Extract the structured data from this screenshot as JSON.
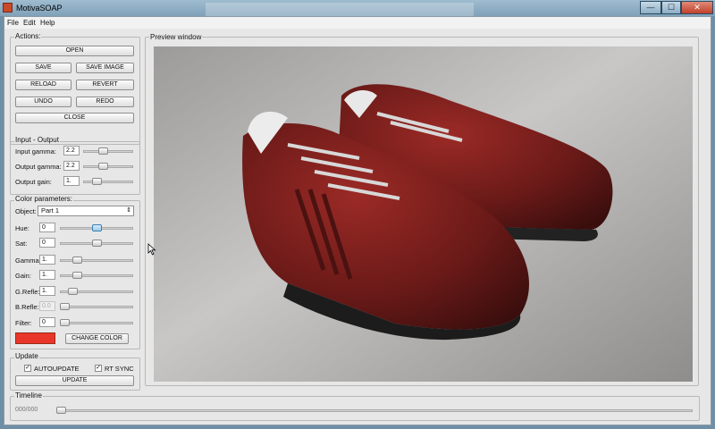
{
  "window": {
    "title": "MotivaSOAP",
    "minimize": "—",
    "maximize": "☐",
    "close": "✕"
  },
  "menu": [
    "File",
    "Edit",
    "Help"
  ],
  "actions": {
    "title": "Actions:",
    "open": "OPEN",
    "save": "SAVE",
    "save_image": "SAVE IMAGE",
    "reload": "RELOAD",
    "revert": "REVERT",
    "undo": "UNDO",
    "redo": "REDO",
    "close": "CLOSE"
  },
  "io": {
    "title": "Input - Output",
    "input_gamma_label": "Input gamma:",
    "input_gamma_value": "2.2",
    "input_gamma_level": 0.38,
    "output_gamma_label": "Output gamma:",
    "output_gamma_value": "2.2",
    "output_gamma_level": 0.38,
    "output_gain_label": "Output gain:",
    "output_gain_value": "1.",
    "output_gain_level": 0.22
  },
  "color": {
    "title": "Color parameters:",
    "object_label": "Object:",
    "object_value": "Part 1",
    "object_arrow": "⇕",
    "hue_label": "Hue:",
    "hue_value": "0",
    "hue_level": 0.5,
    "sat_label": "Sat:",
    "sat_value": "0",
    "sat_level": 0.5,
    "gamma_label": "Gamma:",
    "gamma_value": "1.",
    "gamma_level": 0.2,
    "gain_label": "Gain:",
    "gain_value": "1.",
    "gain_level": 0.2,
    "grefle_label": "G.Refle:",
    "grefle_value": "1.",
    "grefle_level": 0.12,
    "brefle_label": "B.Refle:",
    "brefle_value": "0.0",
    "brefle_level": 0.0,
    "filter_label": "Filter:",
    "filter_value": "0",
    "filter_level": 0.0,
    "swatch_color": "#e8372a",
    "change_color": "CHANGE COLOR"
  },
  "update": {
    "title": "Update",
    "autoupdate": "AUTOUPDATE",
    "autoupdate_checked": "✓",
    "rt_sync": "RT SYNC",
    "rt_sync_checked": "✓",
    "button": "UPDATE"
  },
  "preview": {
    "title": "Preview window",
    "shoe_color": "#7a1c1c"
  },
  "timeline": {
    "title": "Timeline",
    "time": "000/000"
  }
}
